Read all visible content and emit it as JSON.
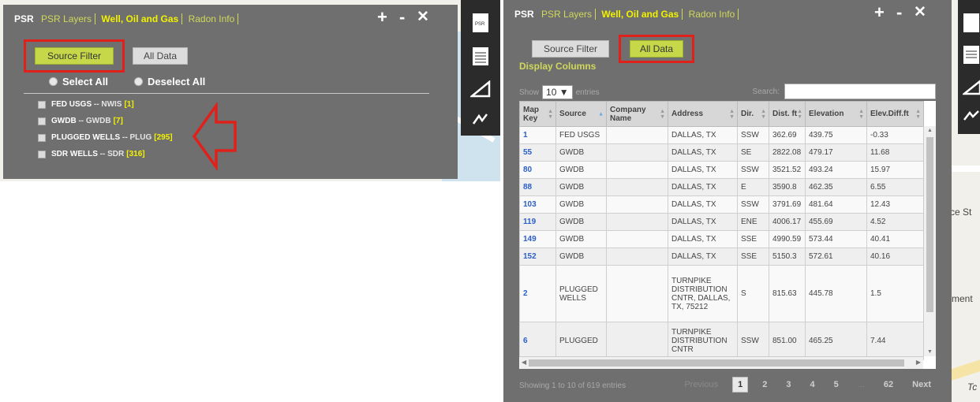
{
  "header": {
    "psr": "PSR",
    "tabs": [
      "PSR Layers",
      "Well, Oil and Gas",
      "Radon Info"
    ],
    "controls": {
      "add": "+",
      "minimize": "-",
      "close": "✕"
    }
  },
  "left_panel": {
    "filter_buttons": {
      "source_filter": "Source Filter",
      "all_data": "All Data"
    },
    "select_all": "Select All",
    "deselect_all": "Deselect All",
    "sources": [
      {
        "name": "FED USGS",
        "code": "-- NWIS",
        "count": "[1]"
      },
      {
        "name": "GWDB",
        "code": "-- GWDB",
        "count": "[7]"
      },
      {
        "name": "PLUGGED WELLS",
        "code": "-- PLUG",
        "count": "[295]"
      },
      {
        "name": "SDR WELLS",
        "code": "-- SDR",
        "count": "[316]"
      }
    ]
  },
  "right_panel": {
    "filter_buttons": {
      "source_filter": "Source Filter",
      "all_data": "All Data"
    },
    "display_columns": "Display Columns",
    "show_label": "Show",
    "entries_value": "10",
    "entries_label": "entries",
    "search_label": "Search:",
    "columns": [
      "Map Key",
      "Source",
      "Company Name",
      "Address",
      "Dir.",
      "Dist. ft",
      "Elevation",
      "Elev.Diff.ft"
    ],
    "rows": [
      [
        "1",
        "FED USGS",
        "",
        "DALLAS, TX",
        "SSW",
        "362.69",
        "439.75",
        "-0.33"
      ],
      [
        "55",
        "GWDB",
        "",
        "DALLAS, TX",
        "SE",
        "2822.08",
        "479.17",
        "11.68"
      ],
      [
        "80",
        "GWDB",
        "",
        "DALLAS, TX",
        "SSW",
        "3521.52",
        "493.24",
        "15.97"
      ],
      [
        "88",
        "GWDB",
        "",
        "DALLAS, TX",
        "E",
        "3590.8",
        "462.35",
        "6.55"
      ],
      [
        "103",
        "GWDB",
        "",
        "DALLAS, TX",
        "SSW",
        "3791.69",
        "481.64",
        "12.43"
      ],
      [
        "119",
        "GWDB",
        "",
        "DALLAS, TX",
        "ENE",
        "4006.17",
        "455.69",
        "4.52"
      ],
      [
        "149",
        "GWDB",
        "",
        "DALLAS, TX",
        "SSE",
        "4990.59",
        "573.44",
        "40.41"
      ],
      [
        "152",
        "GWDB",
        "",
        "DALLAS, TX",
        "SSE",
        "5150.3",
        "572.61",
        "40.16"
      ],
      [
        "2",
        "PLUGGED WELLS",
        "",
        "TURNPIKE DISTRIBUTION CNTR, DALLAS, TX, 75212",
        "S",
        "815.63",
        "445.78",
        "1.5"
      ],
      [
        "6",
        "PLUGGED",
        "",
        "TURNPIKE DISTRIBUTION CNTR",
        "SSW",
        "851.00",
        "465.25",
        "7.44"
      ]
    ],
    "info": "Showing 1 to 10 of 619 entries",
    "pager": {
      "previous": "Previous",
      "pages": [
        "1",
        "2",
        "3",
        "4",
        "5",
        "...",
        "62"
      ],
      "next": "Next"
    }
  },
  "map": {
    "labels": [
      "rce St",
      "ment",
      "Tc"
    ]
  },
  "colors": {
    "panel": "#6f6f6f",
    "accent_green": "#c6d84a",
    "highlight_red": "#e0201a",
    "tab_active": "#f2f200"
  }
}
